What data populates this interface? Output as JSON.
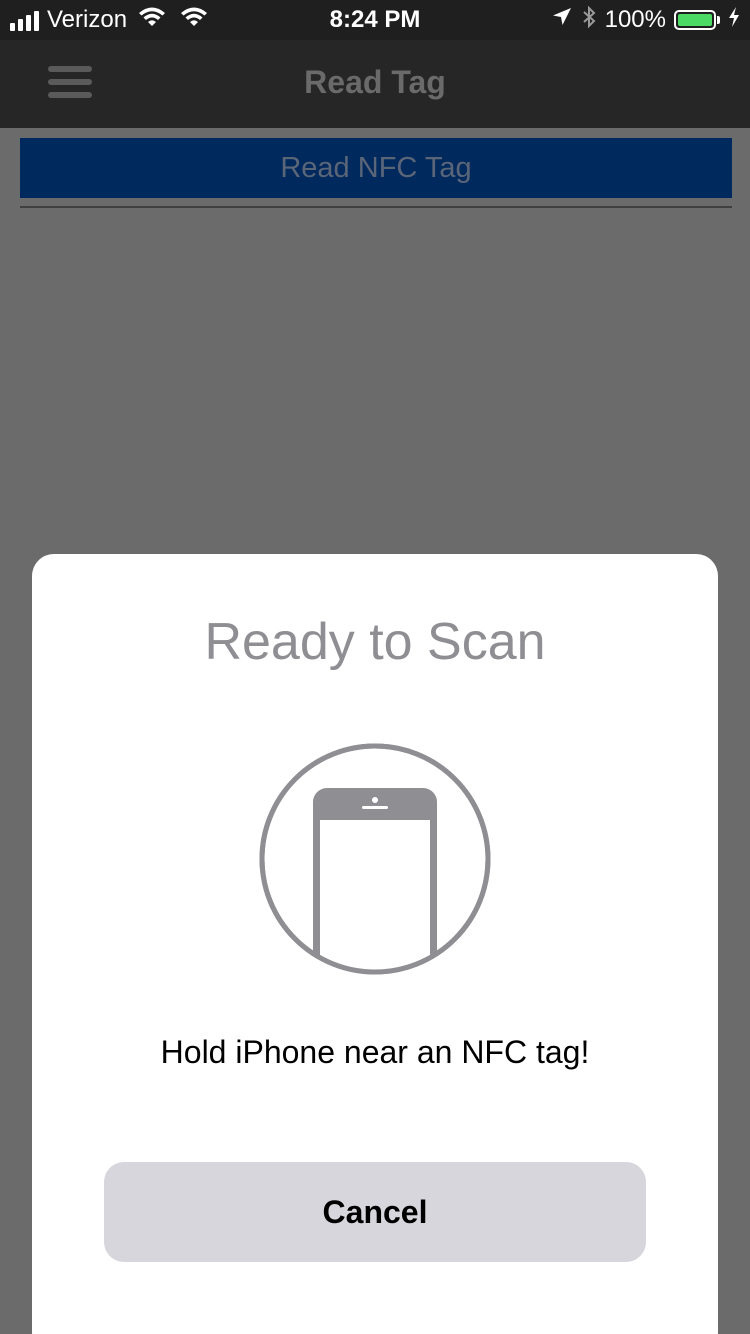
{
  "status_bar": {
    "carrier": "Verizon",
    "time": "8:24 PM",
    "battery_percent": "100%",
    "battery_level": 1.0,
    "icons": [
      "signal-icon",
      "wifi-icon",
      "location-icon",
      "bluetooth-icon",
      "battery-icon",
      "charging-icon"
    ]
  },
  "nav": {
    "title": "Read Tag",
    "menu_icon": "hamburger-menu-icon"
  },
  "main": {
    "read_button_label": "Read NFC Tag"
  },
  "scan_sheet": {
    "title": "Ready to Scan",
    "message": "Hold iPhone near an NFC tag!",
    "cancel_label": "Cancel",
    "graphic_icon": "phone-icon"
  },
  "colors": {
    "overlay_background": "#6b6b6b",
    "nav_background": "#262626",
    "read_button_background": "#00295e",
    "battery_fill": "#4cd964",
    "sheet_background": "#ffffff",
    "cancel_button_background": "#d6d6dc",
    "sheet_title_color": "#8e8e93"
  }
}
